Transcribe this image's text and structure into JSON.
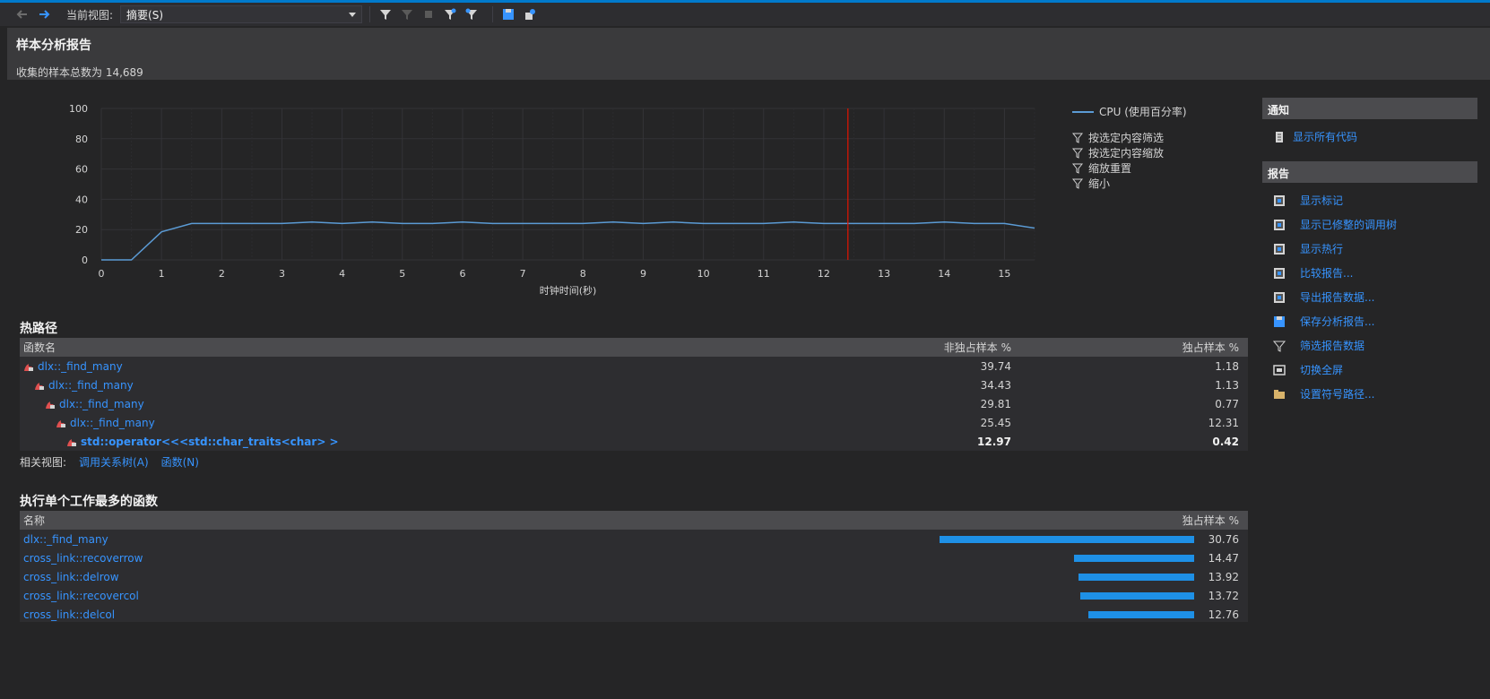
{
  "toolbar": {
    "view_label": "当前视图:",
    "view_value": "摘要(S)"
  },
  "header": {
    "title": "样本分析报告",
    "subtitle": "收集的样本总数为 14,689"
  },
  "chart_data": {
    "type": "line",
    "xlabel": "时钟时间(秒)",
    "ylabel": "",
    "xlim": [
      0,
      15.5
    ],
    "ylim": [
      0,
      100
    ],
    "x_ticks": [
      0,
      1,
      2,
      3,
      4,
      5,
      6,
      7,
      8,
      9,
      10,
      11,
      12,
      13,
      14,
      15
    ],
    "y_ticks": [
      0,
      20,
      40,
      60,
      80,
      100
    ],
    "series": [
      {
        "name": "CPU (使用百分率)",
        "x": [
          0,
          0.5,
          1,
          1.5,
          2,
          2.5,
          3,
          3.5,
          4,
          4.5,
          5,
          5.5,
          6,
          6.5,
          7,
          7.5,
          8,
          8.5,
          9,
          9.5,
          10,
          10.5,
          11,
          11.5,
          12,
          12.5,
          13,
          13.5,
          14,
          14.5,
          15,
          15.5
        ],
        "values": [
          0,
          0,
          18.5,
          24,
          24,
          24,
          24,
          25,
          24,
          25,
          24,
          24,
          25,
          24,
          24,
          24,
          24,
          25,
          24,
          25,
          24,
          24,
          24,
          25,
          24,
          24,
          24,
          24,
          25,
          24,
          24,
          21
        ],
        "color": "#5b9bd5"
      }
    ],
    "marker_x": 12.4,
    "marker_color": "#e51400",
    "grid": true
  },
  "filters": [
    "按选定内容筛选",
    "按选定内容缩放",
    "缩放重置",
    "缩小"
  ],
  "hot_path": {
    "title": "热路径",
    "columns": [
      "函数名",
      "非独占样本 %",
      "独占样本 %"
    ],
    "rows": [
      {
        "name": "dlx::_find_many",
        "inclusive": "39.74",
        "exclusive": "1.18"
      },
      {
        "name": "dlx::_find_many",
        "inclusive": "34.43",
        "exclusive": "1.13"
      },
      {
        "name": "dlx::_find_many",
        "inclusive": "29.81",
        "exclusive": "0.77"
      },
      {
        "name": "dlx::_find_many",
        "inclusive": "25.45",
        "exclusive": "12.31"
      },
      {
        "name": "std::operator<<<std::char_traits<char> >",
        "inclusive": "12.97",
        "exclusive": "0.42"
      }
    ]
  },
  "related": {
    "label": "相关视图:",
    "links": [
      "调用关系树(A)",
      "函数(N)"
    ]
  },
  "top_functions": {
    "title": "执行单个工作最多的函数",
    "columns": [
      "名称",
      "独占样本 %"
    ],
    "rows": [
      {
        "name": "dlx::_find_many",
        "value": 30.76
      },
      {
        "name": "cross_link::recoverrow",
        "value": 14.47
      },
      {
        "name": "cross_link::delrow",
        "value": 13.92
      },
      {
        "name": "cross_link::recovercol",
        "value": 13.72
      },
      {
        "name": "cross_link::delcol",
        "value": 12.76
      }
    ]
  },
  "panel": {
    "notify_title": "通知",
    "notify_items": [
      "显示所有代码"
    ],
    "report_title": "报告",
    "report_items": [
      "显示标记",
      "显示已修整的调用树",
      "显示热行",
      "比较报告...",
      "导出报告数据...",
      "保存分析报告...",
      "筛选报告数据",
      "切换全屏",
      "设置符号路径..."
    ]
  }
}
